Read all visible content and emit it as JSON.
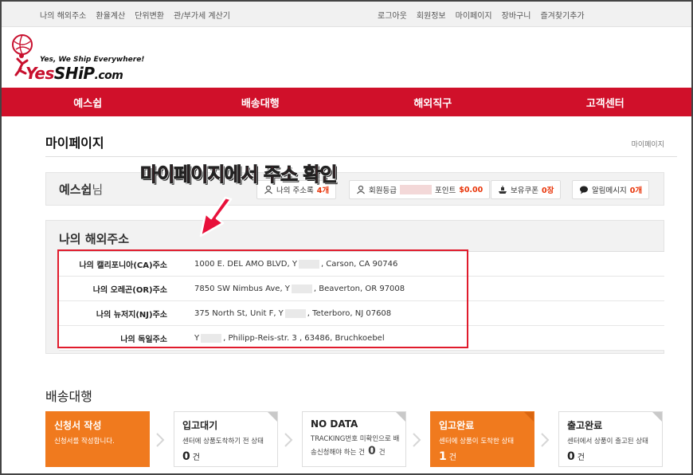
{
  "topbar": {
    "left_links": [
      "나의 해외주소",
      "환율계산",
      "단위변환",
      "관/부가세 계산기"
    ],
    "right_links": [
      "로그아웃",
      "회원정보",
      "마이페이지",
      "장바구니",
      "즐겨찾기추가"
    ]
  },
  "logo": {
    "tagline": "Yes, We Ship Everywhere!",
    "name_part1": "Yes",
    "name_part2": "SHiP",
    "name_part3": ".com"
  },
  "nav": {
    "items": [
      "예스쉽",
      "배송대행",
      "해외직구",
      "고객센터"
    ]
  },
  "page": {
    "title": "마이페이지",
    "breadcrumb": "마이페이지"
  },
  "annotation": {
    "text": "마이페이지에서 주소 확인"
  },
  "user": {
    "name": "예스쉽",
    "suffix": "님",
    "address_book_label": "나의 주소록",
    "address_book_value": "4개",
    "grade_label": "회원등급",
    "point_label": "포인트",
    "point_value": "$0.00",
    "coupon_label": "보유쿠폰",
    "coupon_value": "0장",
    "message_label": "알림메시지",
    "message_value": "0개"
  },
  "addresses": {
    "title": "나의 해외주소",
    "rows": [
      {
        "label": "나의 캘리포니아(CA)주소",
        "pre": "1000 E. DEL AMO BLVD, Y",
        "post": ", Carson, CA   90746"
      },
      {
        "label": "나의 오레곤(OR)주소",
        "pre": "7850 SW Nimbus Ave, Y",
        "post": ", Beaverton, OR   97008"
      },
      {
        "label": "나의 뉴저지(NJ)주소",
        "pre": "375 North St, Unit F, Y",
        "post": ", Teterboro, NJ   07608"
      },
      {
        "label": "나의 독일주소",
        "pre": "Y",
        "post": ", Philipp-Reis-str. 3 , 63486, Bruchkoebel"
      }
    ]
  },
  "shipping": {
    "title": "배송대행",
    "cards": [
      {
        "title": "신청서 작성",
        "desc": "신청서를 작성합니다.",
        "count": "",
        "unit": ""
      },
      {
        "title": "입고대기",
        "desc": "센터에 상품도착하기 전 상태",
        "count": "0",
        "unit": "건"
      },
      {
        "title": "NO DATA",
        "desc": "TRACKING번호 미확인으로 배",
        "desc2": "송신청해야 하는 건",
        "count": "0",
        "unit": "건"
      },
      {
        "title": "입고완료",
        "desc": "센터에 상품이 도착한 상태",
        "count": "1",
        "unit": "건"
      },
      {
        "title": "출고완료",
        "desc": "센터에서 상품이 출고된 상태",
        "count": "0",
        "unit": "건"
      }
    ]
  },
  "colors": {
    "brand_red": "#d0102a",
    "accent_orange": "#f07a1e",
    "highlight_red": "#e01b2c"
  }
}
